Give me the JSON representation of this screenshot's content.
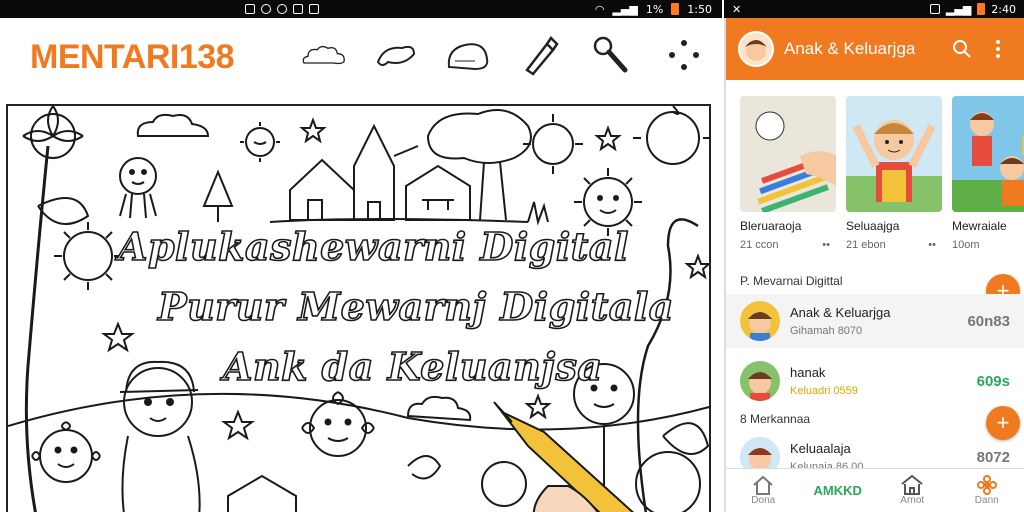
{
  "status_left": {
    "time": "1:50",
    "battery_text": "1%"
  },
  "status_right": {
    "time": "2:40"
  },
  "drawing": {
    "brand": "MENTARI138",
    "tools": [
      "cloud-brush-icon",
      "leaf-brush-icon",
      "fill-blob-icon",
      "marker-icon",
      "dropper-icon",
      "more-dots-icon"
    ],
    "title_lines": [
      "Aplukashewarni Digital",
      "Purur Mewarnj Digitala",
      "Ank da Keluanjsa"
    ]
  },
  "gallery": {
    "title": "Anak & Keluarjga",
    "cards": [
      {
        "name": "Bleruaraoja",
        "meta": "21 ccon"
      },
      {
        "name": "Seluaajga",
        "meta": "21 ebon"
      },
      {
        "name": "Mewraiale",
        "meta": "10om"
      }
    ],
    "section1": "P. Mevarnai Digittal",
    "section2": "8 Merkannaa",
    "rows": [
      {
        "title": "Anak & Keluarjga",
        "sub": "Gihamah 8070",
        "value": "60n83"
      },
      {
        "title": "hanak",
        "sub": "Keluadri 0559",
        "value": "609s"
      },
      {
        "title": "Keluaalaja",
        "sub": "Kelunaia 86.00",
        "value": "8072"
      }
    ],
    "fab_label": "+",
    "nav": [
      {
        "label": "Dona",
        "icon": "home-icon"
      },
      {
        "label": "AMKKD",
        "icon": ""
      },
      {
        "label": "Arnot",
        "icon": "house-icon"
      },
      {
        "label": "Dann",
        "icon": "flower-icon"
      }
    ]
  },
  "colors": {
    "accent": "#f07a1f",
    "nav_active": "#2aa85a"
  }
}
